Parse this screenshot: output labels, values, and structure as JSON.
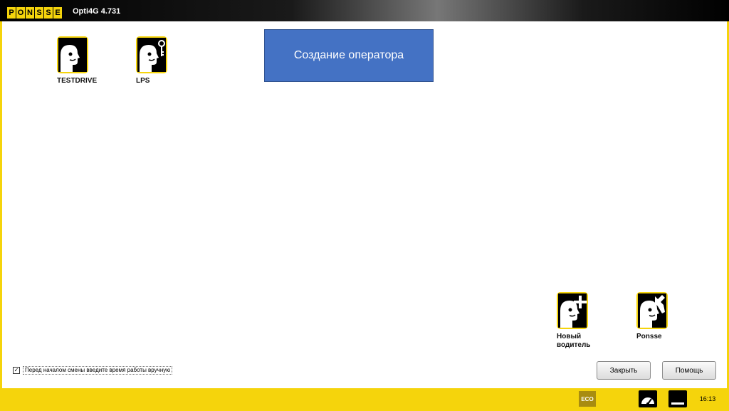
{
  "app": {
    "logo_letters": [
      "P",
      "O",
      "N",
      "S",
      "S",
      "E"
    ],
    "title": "Opti4G 4.731"
  },
  "users": [
    {
      "label": "TESTDRIVE",
      "icon": "operator-icon"
    },
    {
      "label": "LPS",
      "icon": "operator-key-icon"
    },
    {
      "label": "Новый\nводитель",
      "icon": "operator-add-icon"
    },
    {
      "label": "Ponsse",
      "icon": "operator-service-icon"
    }
  ],
  "banner": {
    "text": "Создание оператора"
  },
  "manual_time": {
    "checked_mark": "✓",
    "label": "Перед началом смены введите время работы вручную"
  },
  "buttons": {
    "close": "Закрыть",
    "help": "Помощь"
  },
  "status": {
    "eco": "ECO",
    "time": "16:13"
  },
  "colors": {
    "brand_yellow": "#f5d40c",
    "banner_blue": "#4472c4"
  }
}
